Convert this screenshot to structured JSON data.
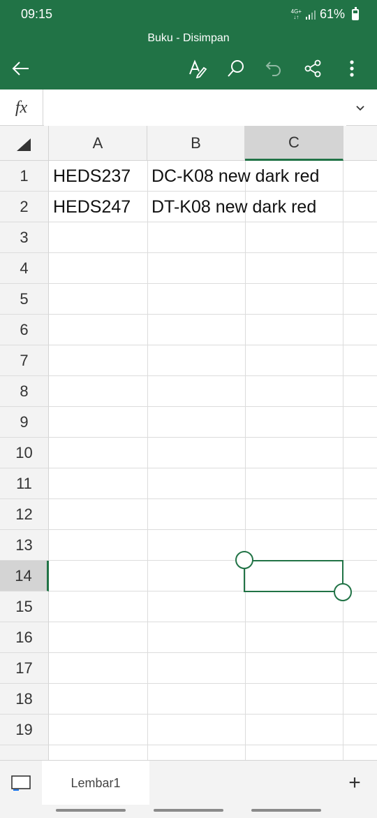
{
  "status_bar": {
    "time": "09:15",
    "network": "4G+",
    "battery": "61%"
  },
  "app_bar": {
    "title": "Buku - Disimpan",
    "icons": [
      "back-arrow-icon",
      "draw-pen-icon",
      "search-icon",
      "undo-icon",
      "share-icon",
      "more-vert-icon"
    ]
  },
  "formula_bar": {
    "fx_label": "fx",
    "value": ""
  },
  "grid": {
    "columns": [
      "A",
      "B",
      "C"
    ],
    "active_column": "C",
    "rows": [
      "1",
      "2",
      "3",
      "4",
      "5",
      "6",
      "7",
      "8",
      "9",
      "10",
      "11",
      "12",
      "13",
      "14",
      "15",
      "16",
      "17",
      "18",
      "19"
    ],
    "active_row": "14",
    "cells": {
      "A1": "HEDS237",
      "B1": "DC-K08 new dark red",
      "A2": "HEDS247",
      "B2": "DT-K08 new dark red"
    },
    "selected_range": "C13:C14"
  },
  "sheet_bar": {
    "tabs": [
      "Lembar1"
    ],
    "add_label": "+"
  },
  "colors": {
    "accent": "#217346",
    "header_bg": "#f3f3f3",
    "gridline": "#dcdcdc"
  }
}
